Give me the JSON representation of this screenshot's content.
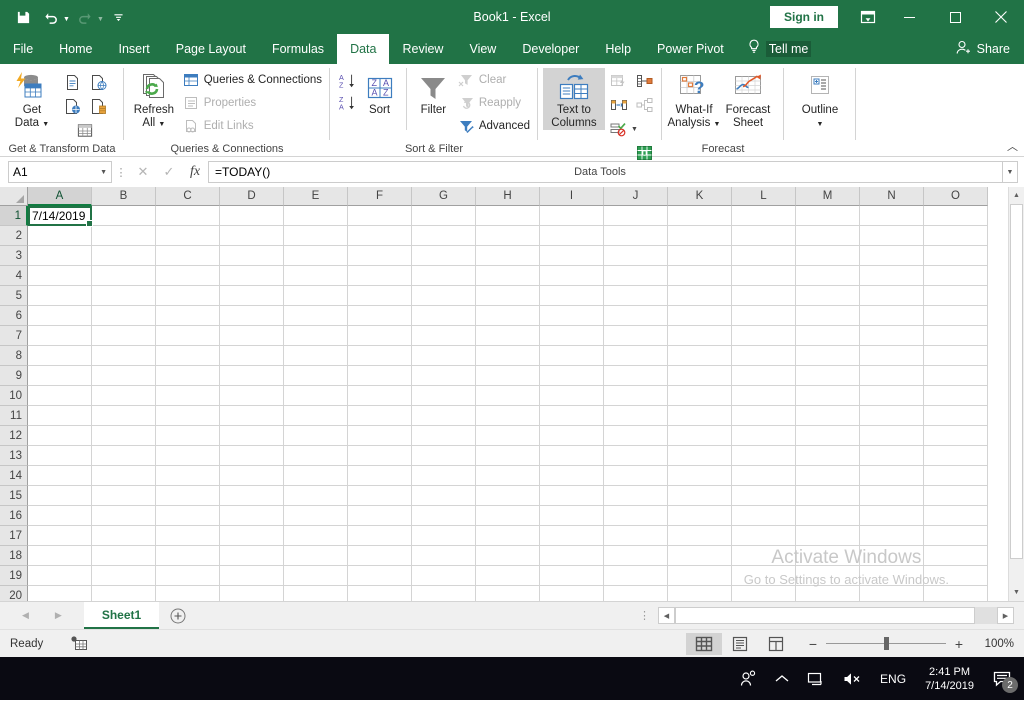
{
  "titlebar": {
    "document_title": "Book1",
    "app_separator": "-",
    "app_name": "Excel",
    "signin_label": "Sign in",
    "qat": [
      {
        "name": "save-icon",
        "label": "Save"
      },
      {
        "name": "undo-icon",
        "label": "Undo"
      },
      {
        "name": "redo-icon",
        "label": "Redo"
      },
      {
        "name": "customize-qat-icon",
        "label": "Customize Quick Access Toolbar"
      }
    ],
    "window_buttons": [
      {
        "name": "ribbon-display-options-icon",
        "label": "Ribbon Display Options"
      },
      {
        "name": "minimize-icon",
        "label": "Minimize"
      },
      {
        "name": "maximize-icon",
        "label": "Maximize"
      },
      {
        "name": "close-icon",
        "label": "Close"
      }
    ]
  },
  "tabs": {
    "items": [
      {
        "label": "File",
        "active": false
      },
      {
        "label": "Home",
        "active": false
      },
      {
        "label": "Insert",
        "active": false
      },
      {
        "label": "Page Layout",
        "active": false
      },
      {
        "label": "Formulas",
        "active": false
      },
      {
        "label": "Data",
        "active": true
      },
      {
        "label": "Review",
        "active": false
      },
      {
        "label": "View",
        "active": false
      },
      {
        "label": "Developer",
        "active": false
      },
      {
        "label": "Help",
        "active": false
      },
      {
        "label": "Power Pivot",
        "active": false
      }
    ],
    "tellme_label": "Tell me",
    "share_label": "Share"
  },
  "ribbon": {
    "groups": [
      {
        "title": "Get & Transform Data",
        "big_buttons": [
          {
            "label_line1": "Get",
            "label_line2": "Data",
            "icon": "get-data-icon",
            "has_caret": true
          }
        ],
        "small_buttons": [
          {
            "label": "",
            "icon": "from-text-csv-icon"
          },
          {
            "label": "",
            "icon": "from-web-icon"
          },
          {
            "label": "",
            "icon": "from-table-range-icon"
          },
          {
            "label": "",
            "icon": "recent-sources-icon"
          },
          {
            "label": "",
            "icon": "existing-connections-icon"
          }
        ]
      },
      {
        "title": "Queries & Connections",
        "big_buttons": [
          {
            "label_line1": "Refresh",
            "label_line2": "All",
            "icon": "refresh-all-icon",
            "has_caret": true
          }
        ],
        "small_buttons": [
          {
            "label": "Queries & Connections",
            "icon": "queries-connections-icon",
            "disabled": false
          },
          {
            "label": "Properties",
            "icon": "properties-icon",
            "disabled": true
          },
          {
            "label": "Edit Links",
            "icon": "edit-links-icon",
            "disabled": true
          }
        ]
      },
      {
        "title": "Sort & Filter",
        "small_buttons": [
          {
            "label": "",
            "icon": "sort-ascending-icon",
            "disabled": false
          },
          {
            "label": "",
            "icon": "sort-descending-icon",
            "disabled": false
          },
          {
            "label": "Clear",
            "icon": "clear-filter-icon",
            "disabled": true
          },
          {
            "label": "Reapply",
            "icon": "reapply-icon",
            "disabled": true
          },
          {
            "label": "Advanced",
            "icon": "advanced-filter-icon",
            "disabled": false
          }
        ],
        "big_buttons": [
          {
            "label_line1": "Sort",
            "label_line2": "",
            "icon": "sort-icon"
          },
          {
            "label_line1": "Filter",
            "label_line2": "",
            "icon": "filter-icon"
          }
        ]
      },
      {
        "title": "Data Tools",
        "big_buttons": [
          {
            "label_line1": "Text to",
            "label_line2": "Columns",
            "icon": "text-to-columns-icon",
            "selected": true
          }
        ],
        "small_buttons": [
          {
            "label": "",
            "icon": "flash-fill-icon",
            "disabled": true
          },
          {
            "label": "",
            "icon": "relationships-icon",
            "disabled": true
          },
          {
            "label": "",
            "icon": "remove-duplicates-icon",
            "disabled": false
          },
          {
            "label": "",
            "icon": "manage-data-model-icon",
            "disabled": true
          },
          {
            "label": "",
            "icon": "data-validation-icon",
            "disabled": false
          },
          {
            "label": "",
            "icon": "consolidate-icon",
            "disabled": false
          }
        ]
      },
      {
        "title": "Forecast",
        "big_buttons": [
          {
            "label_line1": "What-If",
            "label_line2": "Analysis",
            "icon": "what-if-analysis-icon",
            "has_caret": true
          },
          {
            "label_line1": "Forecast",
            "label_line2": "Sheet",
            "icon": "forecast-sheet-icon"
          }
        ]
      },
      {
        "title": "",
        "big_buttons": [
          {
            "label_line1": "Outline",
            "label_line2": "",
            "icon": "outline-icon",
            "has_caret": true
          }
        ]
      }
    ],
    "collapse_label": "Collapse the Ribbon"
  },
  "formula_bar": {
    "name_box_value": "A1",
    "cancel_icon": "cancel-icon",
    "enter_icon": "enter-icon",
    "fx_label": "fx",
    "formula_value": "=TODAY()",
    "expand_icon": "expand-formula-bar-icon"
  },
  "grid": {
    "columns": [
      "A",
      "B",
      "C",
      "D",
      "E",
      "F",
      "G",
      "H",
      "I",
      "J",
      "K",
      "L",
      "M",
      "N",
      "O"
    ],
    "rows": [
      1,
      2,
      3,
      4,
      5,
      6,
      7,
      8,
      9,
      10,
      11,
      12,
      13,
      14,
      15,
      16,
      17,
      18,
      19,
      20
    ],
    "active_cell": "A1",
    "cell_values": {
      "A1": "7/14/2019"
    },
    "watermark_line1": "Activate Windows",
    "watermark_line2": "Go to Settings to activate Windows."
  },
  "sheet_bar": {
    "prev_icon": "previous-sheet-icon",
    "next_icon": "next-sheet-icon",
    "sheets": [
      {
        "label": "Sheet1",
        "active": true
      }
    ],
    "add_sheet_icon": "add-sheet-icon"
  },
  "status_bar": {
    "status_text": "Ready",
    "macro_icon": "record-macro-icon",
    "views": [
      {
        "name": "normal-view-icon",
        "label": "Normal",
        "selected": true
      },
      {
        "name": "page-layout-view-icon",
        "label": "Page Layout",
        "selected": false
      },
      {
        "name": "page-break-preview-icon",
        "label": "Page Break Preview",
        "selected": false
      }
    ],
    "zoom_out_label": "−",
    "zoom_in_label": "+",
    "zoom_level": "100%"
  },
  "taskbar": {
    "items": [
      {
        "name": "people-icon",
        "label": "People"
      },
      {
        "name": "show-hidden-icons-chevron-icon",
        "label": "Show hidden icons"
      },
      {
        "name": "network-icon",
        "label": "Network"
      },
      {
        "name": "volume-muted-icon",
        "label": "Volume muted"
      }
    ],
    "language": "ENG",
    "time": "2:41 PM",
    "date": "7/14/2019",
    "notification_icon": "action-center-icon",
    "notification_count": "2"
  },
  "colors": {
    "excel_green": "#217346",
    "ribbon_bg": "#ffffff",
    "header_gray": "#e6e6e6",
    "taskbar": "#0a0a12"
  }
}
